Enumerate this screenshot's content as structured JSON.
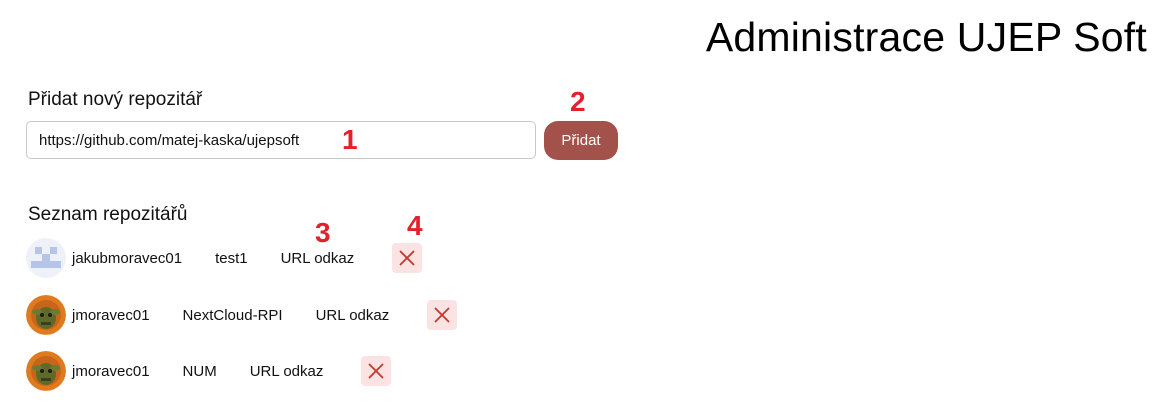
{
  "header": {
    "title": "Administrace UJEP Soft"
  },
  "add_repo": {
    "label": "Přidat nový repozitář",
    "input_value": "https://github.com/matej-kaska/ujepsoft",
    "button_label": "Přidat"
  },
  "annotations": [
    "1",
    "2",
    "3",
    "4"
  ],
  "repo_list": {
    "label": "Seznam repozitářů",
    "items": [
      {
        "owner": "jakubmoravec01",
        "repo": "test1",
        "link_label": "URL odkaz",
        "avatar_icon": "identicon-avatar",
        "delete_icon": "close-icon"
      },
      {
        "owner": "jmoravec01",
        "repo": "NextCloud-RPI",
        "link_label": "URL odkaz",
        "avatar_icon": "character-avatar",
        "delete_icon": "close-icon"
      },
      {
        "owner": "jmoravec01",
        "repo": "NUM",
        "link_label": "URL odkaz",
        "avatar_icon": "character-avatar",
        "delete_icon": "close-icon"
      }
    ]
  },
  "colors": {
    "accent_button": "#a3524b",
    "annotation_red": "#e3202b",
    "delete_bg": "#fbe3e3",
    "delete_x": "#c0392b"
  }
}
